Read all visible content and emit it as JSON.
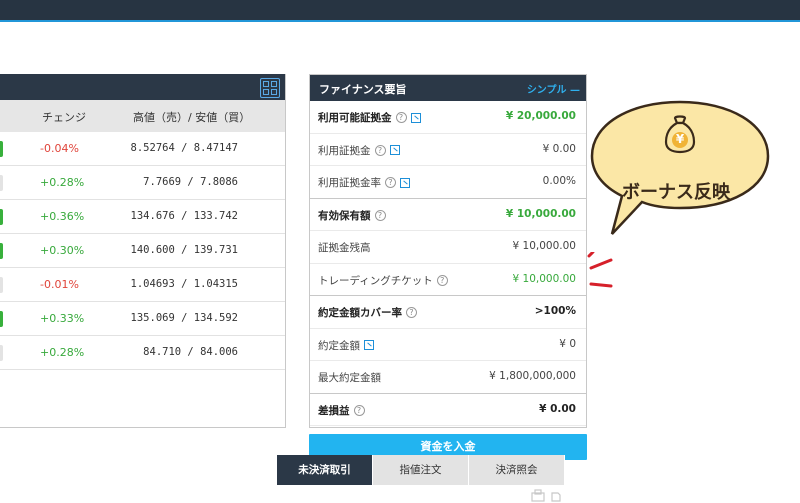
{
  "quotes": {
    "columns": [
      "チェンジ",
      "高値（売）/ 安値（買）"
    ],
    "rows": [
      {
        "change": "-0.04%",
        "rate": "8.52764 / 8.47147",
        "change_color": "#e0443a",
        "indicator": "#38b03c"
      },
      {
        "change": "+0.28%",
        "rate": "7.7669 / 7.8086",
        "change_color": "#38a93c",
        "indicator": "#e3e3e3"
      },
      {
        "change": "+0.36%",
        "rate": "134.676 / 133.742",
        "change_color": "#38a93c",
        "indicator": "#38b03c"
      },
      {
        "change": "+0.30%",
        "rate": "140.600 / 139.731",
        "change_color": "#38a93c",
        "indicator": "#38b03c"
      },
      {
        "change": "-0.01%",
        "rate": "1.04693 / 1.04315",
        "change_color": "#e0443a",
        "indicator": "#e3e3e3"
      },
      {
        "change": "+0.33%",
        "rate": "135.069 / 134.592",
        "change_color": "#38a93c",
        "indicator": "#38b03c"
      },
      {
        "change": "+0.28%",
        "rate": "84.710 / 84.006",
        "change_color": "#38a93c",
        "indicator": "#e3e3e3"
      }
    ]
  },
  "finance": {
    "title": "ファイナンス要旨",
    "simple_label": "シンプル —",
    "rows": [
      {
        "label": "利用可能証拠金",
        "value": "¥ 20,000.00",
        "bold": true,
        "green": true,
        "help": true,
        "ext": true
      },
      {
        "label": "利用証拠金",
        "value": "¥ 0.00",
        "help": true,
        "ext": true
      },
      {
        "label": "利用証拠金率",
        "value": "0.00%",
        "help": true,
        "ext": true,
        "sep": true
      },
      {
        "label": "有効保有額",
        "value": "¥ 10,000.00",
        "bold": true,
        "green": true,
        "help": true
      },
      {
        "label": "証拠金残高",
        "value": "¥ 10,000.00"
      },
      {
        "label": "トレーディングチケット",
        "value": "¥ 10,000.00",
        "green": true,
        "help": true,
        "sep": true
      },
      {
        "label": "約定金額カバー率",
        "value": ">100%",
        "bold": true,
        "valbold": true,
        "help": true
      },
      {
        "label": "約定金額",
        "value": "¥ 0",
        "ext": true
      },
      {
        "label": "最大約定金額",
        "value": "¥ 1,800,000,000",
        "sep": true
      },
      {
        "label": "差損益",
        "value": "¥ 0.00",
        "bold": true,
        "valbold": true,
        "help": true
      }
    ]
  },
  "deposit_button": "資金を入金",
  "tabs": [
    {
      "label": "未決済取引",
      "active": true
    },
    {
      "label": "指値注文",
      "active": false
    },
    {
      "label": "決済照会",
      "active": false
    }
  ],
  "bubble": {
    "text": "ボーナス反映",
    "coin_symbol": "¥"
  },
  "icons": [
    "grid-view-icon",
    "help-icon",
    "external-link-icon",
    "money-bag-icon",
    "print-icon"
  ],
  "colors": {
    "header": "#2b3847",
    "accent": "#22b4f0",
    "positive": "#38a93c",
    "negative": "#e0443a"
  }
}
